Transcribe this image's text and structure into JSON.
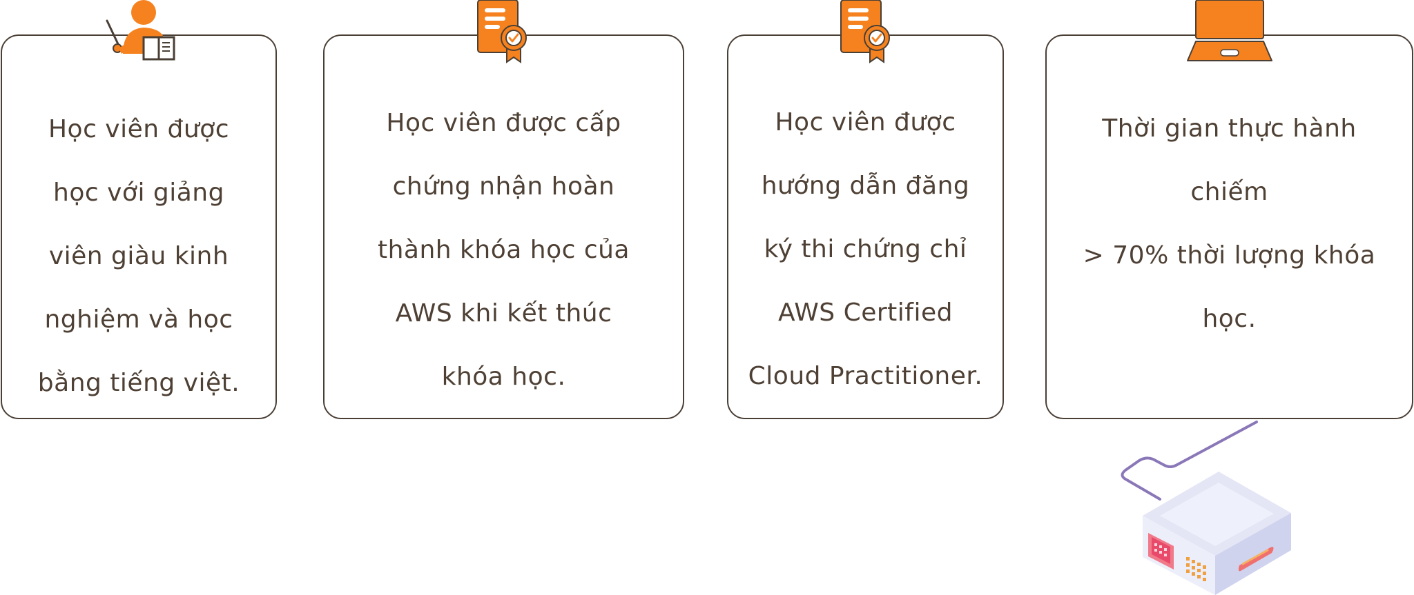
{
  "cards": [
    {
      "icon": "teacher-icon",
      "lines": [
        "Học viên được",
        "học với giảng",
        "viên giàu kinh",
        "nghiệm và học",
        "bằng tiếng việt."
      ]
    },
    {
      "icon": "certificate-icon",
      "lines": [
        "Học viên được cấp",
        "chứng nhận hoàn",
        "thành khóa học của",
        "AWS khi kết thúc",
        "khóa học."
      ]
    },
    {
      "icon": "certificate-icon",
      "lines": [
        "Học viên được",
        "hướng dẫn đăng",
        "ký thi chứng chỉ",
        "AWS Certified",
        "Cloud Practitioner."
      ]
    },
    {
      "icon": "laptop-icon",
      "lines": [
        "Thời gian thực hành",
        "chiếm",
        "> 70% thời lượng khóa",
        "học."
      ]
    }
  ],
  "colors": {
    "accent": "#f5821f",
    "border": "#4a3f35",
    "text": "#4e4034",
    "cable": "#8a77b8"
  }
}
